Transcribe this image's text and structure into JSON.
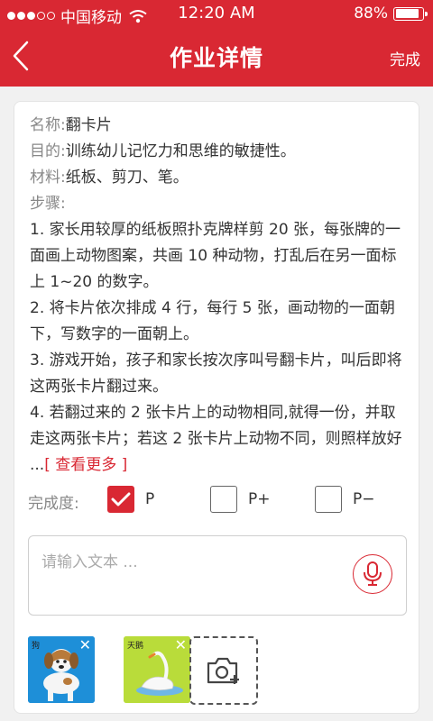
{
  "status": {
    "carrier": "中国移动",
    "time": "12:20 AM",
    "battery": "88%",
    "battery_level": 0.88
  },
  "nav": {
    "title": "作业详情",
    "done_label": "完成",
    "back_icon": "chevron-left-icon"
  },
  "detail": {
    "name_label": "名称:",
    "name_value": "翻卡片",
    "goal_label": "目的:",
    "goal_value": "训练幼儿记忆力和思维的敏捷性。",
    "material_label": "材料:",
    "material_value": "纸板、剪刀、笔。",
    "steps_label": "步骤:",
    "steps_text": "1. 家长用较厚的纸板照扑克牌样剪 20 张，每张牌的一面画上动物图案，共画 10 种动物，打乱后在另一面标上 1~20 的数字。\n2. 将卡片依次排成 4 行，每行 5 张，画动物的一面朝下，写数字的一面朝上。\n3. 游戏开始，孩子和家长按次序叫号翻卡片，叫后即将这两张卡片翻过来。\n4. 若翻过来的 2 张卡片上的动物相同,就得一份，并取走这两张卡片；若这 2 张卡片上动物不同，则照样放好 ...",
    "more_label": "[ 查看更多 ]"
  },
  "progress": {
    "label": "完成度:",
    "options": [
      {
        "label": "P",
        "checked": true
      },
      {
        "label": "P+",
        "checked": false
      },
      {
        "label": "P−",
        "checked": false
      }
    ]
  },
  "input": {
    "placeholder": "请输入文本 ...",
    "mic_icon": "microphone-icon"
  },
  "photos": [
    {
      "caption": "狗",
      "subject": "dog"
    },
    {
      "caption": "天鹅",
      "subject": "swan"
    }
  ],
  "add_photo_icon": "camera-add-icon",
  "colors": {
    "accent": "#d92833",
    "background": "#f1f1f1"
  }
}
